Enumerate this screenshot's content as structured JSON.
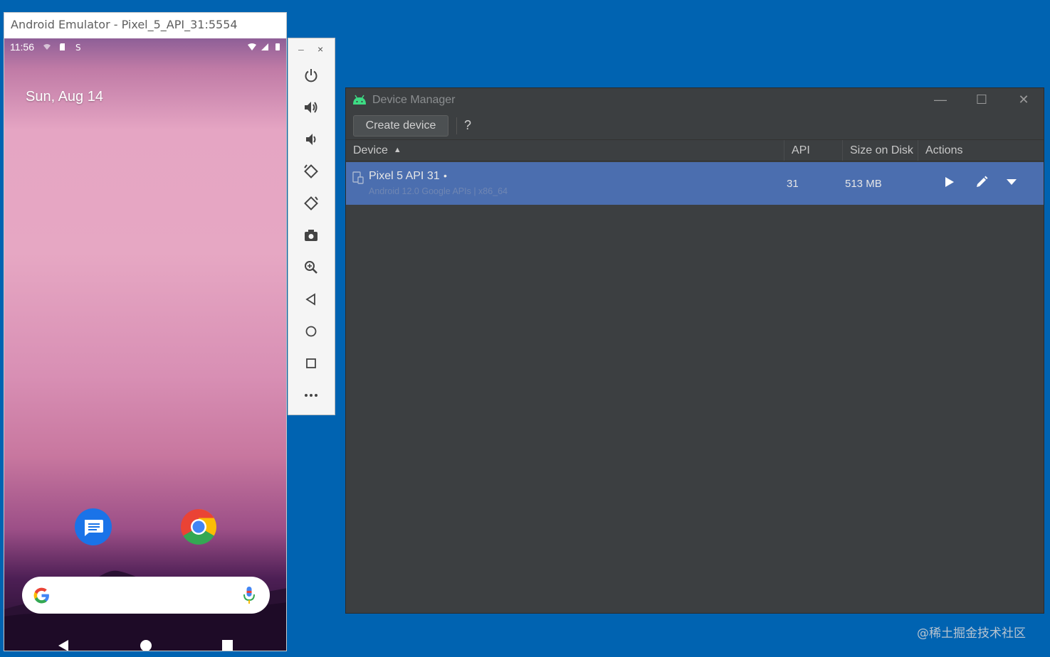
{
  "emulator": {
    "window_title": "Android Emulator - Pixel_5_API_31:5554",
    "status": {
      "time": "11:56"
    },
    "home": {
      "date": "Sun, Aug 14"
    },
    "apps": [
      {
        "name": "Messages",
        "icon": "messages-icon"
      },
      {
        "name": "Chrome",
        "icon": "chrome-icon"
      }
    ],
    "search_bar": {
      "left_icon": "google-g-icon",
      "right_icon": "microphone-icon"
    },
    "nav": [
      "back-icon",
      "home-icon",
      "recents-icon"
    ]
  },
  "emulator_toolbar": {
    "minimize": "–",
    "close": "×",
    "buttons": [
      "power-icon",
      "volume-up-icon",
      "volume-down-icon",
      "rotate-left-icon",
      "rotate-right-icon",
      "camera-icon",
      "zoom-icon",
      "back-icon",
      "home-icon",
      "overview-icon",
      "more-icon"
    ]
  },
  "device_manager": {
    "title": "Device Manager",
    "window_controls": {
      "minimize": "—",
      "maximize": "☐",
      "close": "✕"
    },
    "toolbar": {
      "create_label": "Create device",
      "help_label": "?"
    },
    "columns": {
      "device": "Device",
      "api": "API",
      "size": "Size on Disk",
      "actions": "Actions"
    },
    "rows": [
      {
        "name": "Pixel 5 API 31",
        "dot": "•",
        "subtitle": "Android 12.0 Google APIs | x86_64",
        "api": "31",
        "size": "513 MB",
        "actions": [
          "run-icon",
          "edit-icon",
          "more-dropdown-icon"
        ]
      }
    ],
    "colors": {
      "selection": "#4b6eaf",
      "background": "#3c3f41"
    }
  },
  "watermark": "@稀土掘金技术社区"
}
